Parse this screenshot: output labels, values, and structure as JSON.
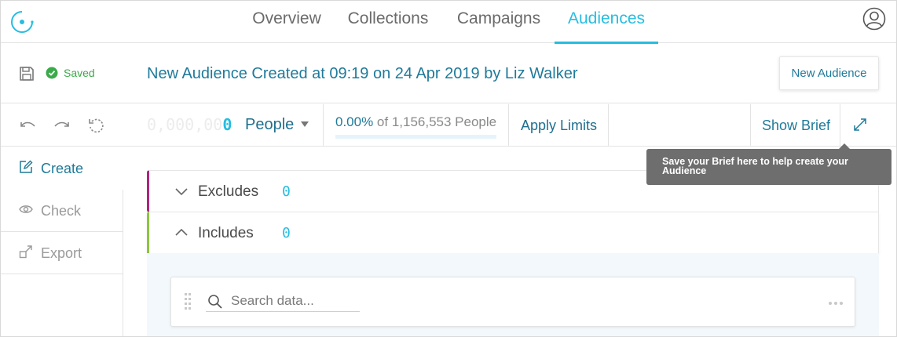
{
  "nav": {
    "tabs": [
      {
        "label": "Overview",
        "active": false
      },
      {
        "label": "Collections",
        "active": false
      },
      {
        "label": "Campaigns",
        "active": false
      },
      {
        "label": "Audiences",
        "active": true
      }
    ]
  },
  "header": {
    "saved_label": "Saved",
    "title": "New Audience Created at 09:19 on 24 Apr 2019 by Liz Walker",
    "new_audience_label": "New Audience"
  },
  "toolbar": {
    "counter_ghost": "0,000,00",
    "counter_live": "0",
    "unit_label": "People",
    "percent_value": "0.00%",
    "percent_rest": " of 1,156,553 People",
    "percent_fraction": 0,
    "apply_limits_label": "Apply Limits",
    "show_brief_label": "Show Brief"
  },
  "tooltip": {
    "text": "Save your Brief here to help create your Audience"
  },
  "sidemenu": {
    "items": [
      {
        "label": "Create",
        "icon": "edit-icon",
        "active": true
      },
      {
        "label": "Check",
        "icon": "eye-icon",
        "active": false
      },
      {
        "label": "Export",
        "icon": "export-icon",
        "active": false
      }
    ]
  },
  "sections": {
    "excludes": {
      "label": "Excludes",
      "count": "0"
    },
    "includes": {
      "label": "Includes",
      "count": "0"
    }
  },
  "search": {
    "placeholder": "Search data..."
  },
  "colors": {
    "accent": "#26bde0",
    "title": "#1f7a9a",
    "saved": "#3aaa4a",
    "excludes_bar": "#b0247d",
    "includes_bar": "#8cc63f",
    "tooltip_bg": "#6e6e6e"
  }
}
